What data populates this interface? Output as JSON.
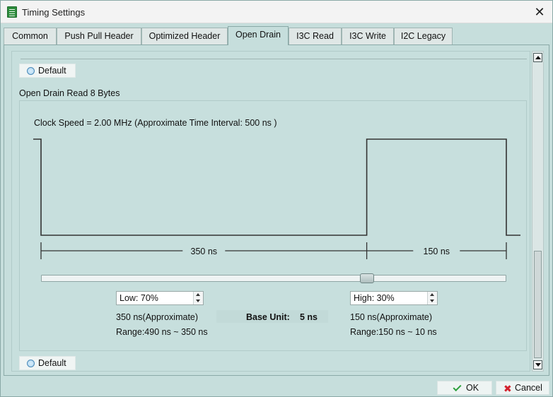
{
  "window": {
    "title": "Timing Settings",
    "close_glyph": "✕"
  },
  "tabs": [
    {
      "label": "Common",
      "active": false
    },
    {
      "label": "Push Pull Header",
      "active": false
    },
    {
      "label": "Optimized Header",
      "active": false
    },
    {
      "label": "Open Drain",
      "active": true
    },
    {
      "label": "I3C Read",
      "active": false
    },
    {
      "label": "I3C Write",
      "active": false
    },
    {
      "label": "I2C Legacy",
      "active": false
    }
  ],
  "section": {
    "default_top_label": "Default",
    "title": "Open Drain Read 8 Bytes",
    "clock_text": "Clock Speed = 2.00 MHz  (Approximate Time Interval: 500 ns )",
    "low_duration_label": "350 ns",
    "high_duration_label": "150 ns",
    "slider_fraction": 0.7,
    "low": {
      "spin_value": "Low: 70%",
      "approx": "350 ns(Approximate)",
      "range": "Range:490 ns ~ 350 ns"
    },
    "high": {
      "spin_value": "High: 30%",
      "approx": "150 ns(Approximate)",
      "range": "Range:150 ns ~  10 ns"
    },
    "base_unit_label": "Base Unit:",
    "base_unit_value": "5 ns",
    "default_bottom_label": "Default"
  },
  "footer": {
    "ok_label": "OK",
    "cancel_label": "Cancel"
  },
  "icons": {
    "app": "app-icon",
    "radio": "radio-icon",
    "ok": "check-icon",
    "cancel": "x-icon"
  },
  "colors": {
    "panel_bg": "#c6dedc",
    "waveform": "#333333",
    "ok_check": "#2aa03a",
    "cancel_x": "#d3202c"
  }
}
